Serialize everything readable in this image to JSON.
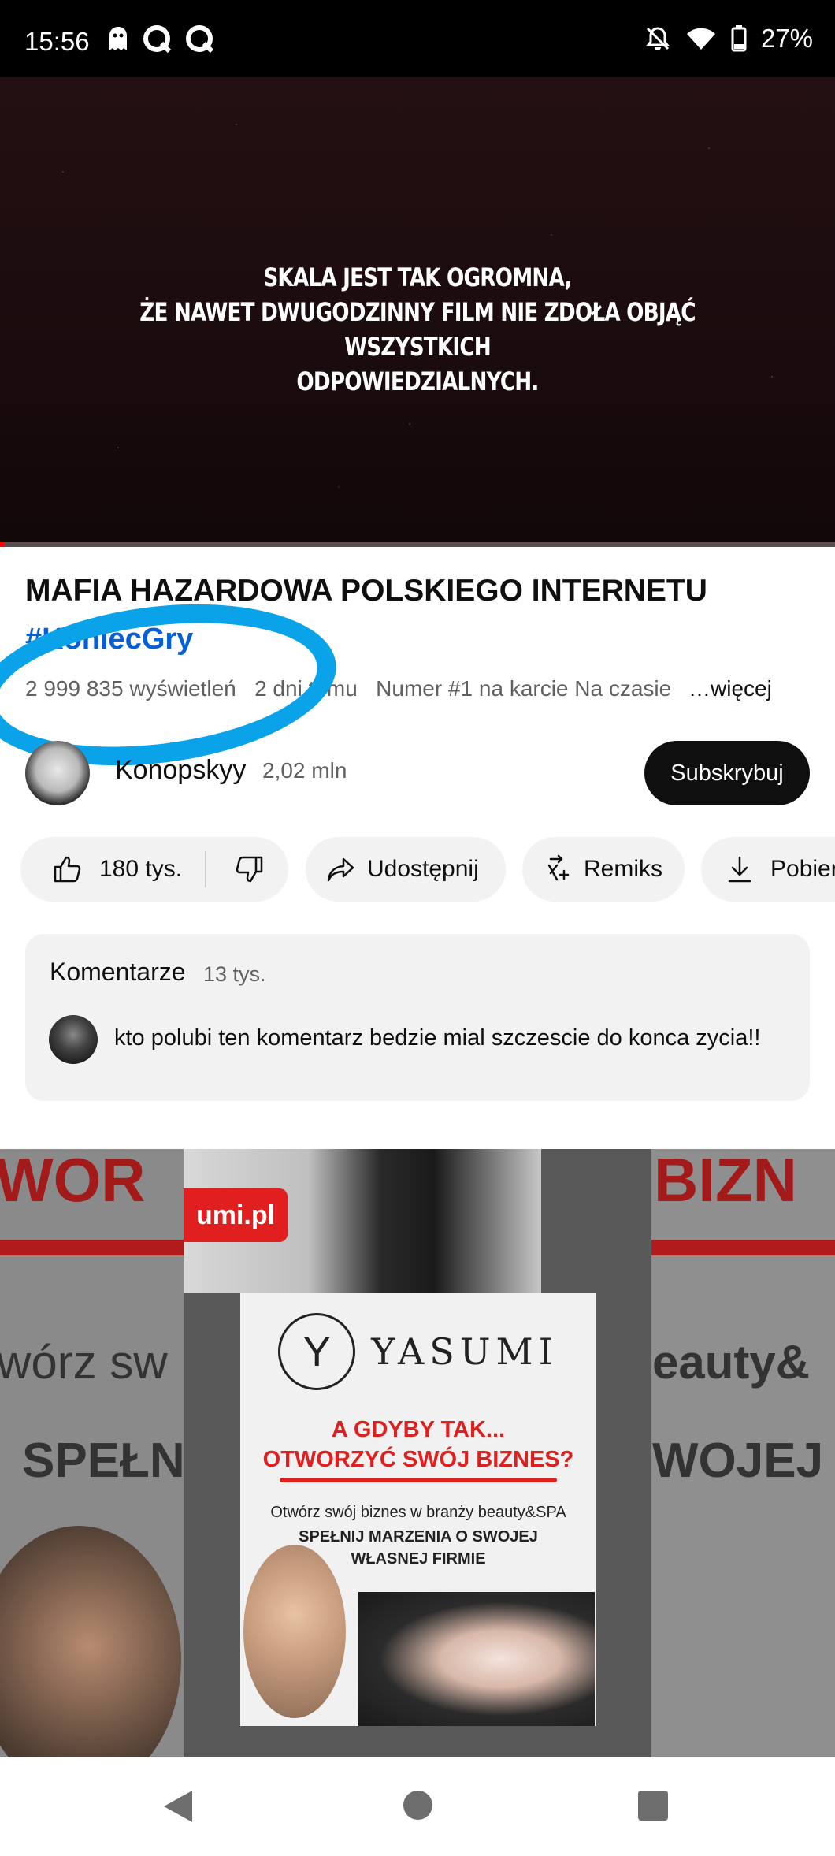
{
  "status_bar": {
    "time": "15:56",
    "battery": "27%",
    "icons_left": [
      "ghost-icon",
      "q-icon",
      "q-icon"
    ],
    "icons_right": [
      "bell-off-icon",
      "wifi-icon",
      "battery-icon"
    ]
  },
  "video": {
    "caption_lines": [
      "SKALA JEST TAK OGROMNA,",
      "ŻE NAWET DWUGODZINNY FILM NIE ZDOŁA OBJĄĆ WSZYSTKICH",
      "ODPOWIEDZIALNYCH."
    ],
    "progress": 0.005
  },
  "details": {
    "title": "MAFIA HAZARDOWA POLSKIEGO INTERNETU",
    "hashtag": "#KoniecGry",
    "views": "2 999 835 wyświetleń",
    "age": "2 dni temu",
    "trending": "Numer #1 na karcie Na czasie",
    "more": "…więcej"
  },
  "channel": {
    "name": "Konopskyy",
    "subscribers": "2,02 mln",
    "subscribe_label": "Subskrybuj"
  },
  "actions": {
    "likes": "180 tys.",
    "share": "Udostępnij",
    "remix": "Remiks",
    "download": "Pobierz"
  },
  "comments": {
    "title": "Komentarze",
    "count": "13 tys.",
    "top_comment": "kto polubi ten komentarz bedzie mial szczescie do konca zycia!!"
  },
  "ad": {
    "tag": "umi.pl",
    "brand": "YASUMI",
    "headline_lines": [
      "A GDYBY TAK...",
      "OTWORZYĆ SWÓJ BIZNES?"
    ],
    "sub": "Otwórz swój biznes w branży beauty&SPA",
    "sub2_lines": [
      "SPEŁNIJ MARZENIA O SWOJEJ",
      "WŁASNEJ FIRMIE"
    ],
    "bg_left": [
      "WOR",
      "wórz sw",
      "SPEŁN"
    ],
    "bg_right": [
      "BIZN",
      "eauty&",
      "WOJEJ"
    ]
  },
  "colors": {
    "accent_red": "#ff0000",
    "link_blue": "#065fd4",
    "annotation_blue": "#0aa3ea",
    "chip_bg": "#f2f2f2"
  }
}
